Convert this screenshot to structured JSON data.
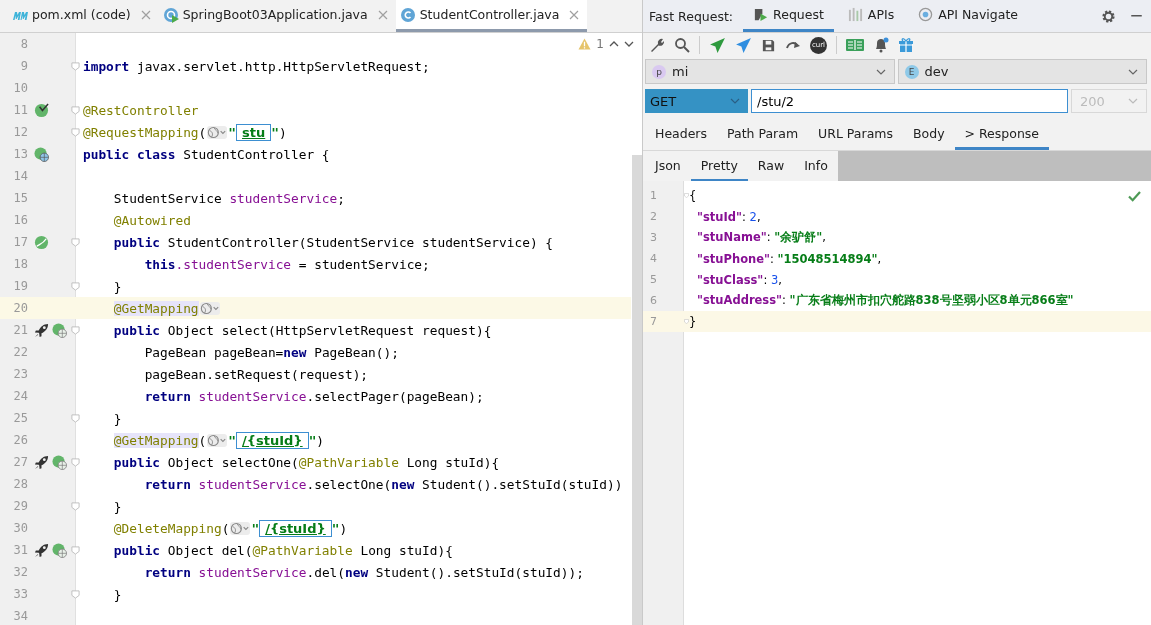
{
  "editor_tabs": [
    {
      "label": "pom.xml (code)",
      "selected": false
    },
    {
      "label": "SpringBoot03Application.java",
      "selected": false
    },
    {
      "label": "StudentController.java",
      "selected": true
    }
  ],
  "inspections": {
    "warnings": "1"
  },
  "code_lines": [
    {
      "number": "8",
      "fold": false,
      "current": false
    },
    {
      "number": "9",
      "fold": true,
      "current": false,
      "tokens": [
        {
          "kind": "kw",
          "text": "import"
        },
        {
          "kind": "plain",
          "text": " javax.servlet.http.HttpServletRequest;"
        }
      ]
    },
    {
      "number": "10",
      "fold": false,
      "current": false
    },
    {
      "number": "11",
      "markers": [
        {
          "kind": "bean-check"
        }
      ],
      "fold": true,
      "current": false,
      "tokens": [
        {
          "kind": "ann",
          "text": "@RestController"
        }
      ]
    },
    {
      "number": "12",
      "fold": true,
      "current": false,
      "tokens": [
        {
          "kind": "ann",
          "text": "@RequestMapping"
        },
        {
          "kind": "plain",
          "text": "("
        },
        {
          "kind": "hint"
        },
        {
          "kind": "str",
          "text": "\""
        },
        {
          "kind": "url",
          "text": "stu"
        },
        {
          "kind": "str",
          "text": "\""
        },
        {
          "kind": "plain",
          "text": ")"
        }
      ]
    },
    {
      "number": "13",
      "markers": [
        {
          "kind": "bean-web"
        }
      ],
      "fold": false,
      "current": false,
      "tokens": [
        {
          "kind": "kw",
          "text": "public class"
        },
        {
          "kind": "plain",
          "text": " StudentController {"
        }
      ]
    },
    {
      "number": "14",
      "fold": false,
      "current": false
    },
    {
      "number": "15",
      "fold": false,
      "current": false,
      "tokens": [
        {
          "kind": "plain",
          "text": "    StudentService "
        },
        {
          "kind": "field",
          "text": "studentService"
        },
        {
          "kind": "plain",
          "text": ";"
        }
      ]
    },
    {
      "number": "16",
      "fold": false,
      "current": false,
      "tokens": [
        {
          "kind": "ann",
          "text": "    @Autowired"
        }
      ]
    },
    {
      "number": "17",
      "markers": [
        {
          "kind": "bean"
        }
      ],
      "fold": true,
      "current": false,
      "tokens": [
        {
          "kind": "kw",
          "text": "    public"
        },
        {
          "kind": "plain",
          "text": " StudentController(StudentService studentService) {"
        }
      ]
    },
    {
      "number": "18",
      "fold": false,
      "current": false,
      "tokens": [
        {
          "kind": "kw",
          "text": "        this"
        },
        {
          "kind": "field",
          "text": ".studentService"
        },
        {
          "kind": "plain",
          "text": " = studentService;"
        }
      ]
    },
    {
      "number": "19",
      "fold": true,
      "current": false,
      "tokens": [
        {
          "kind": "plain",
          "text": "    }"
        }
      ]
    },
    {
      "number": "20",
      "fold": false,
      "current": true,
      "tokens": [
        {
          "kind": "annhl",
          "text": "    @GetMapping"
        },
        {
          "kind": "hint"
        }
      ]
    },
    {
      "number": "21",
      "markers": [
        {
          "kind": "rocket"
        },
        {
          "kind": "web"
        }
      ],
      "fold": true,
      "current": false,
      "tokens": [
        {
          "kind": "kw",
          "text": "    public"
        },
        {
          "kind": "plain",
          "text": " Object select(HttpServletRequest request){"
        }
      ]
    },
    {
      "number": "22",
      "fold": false,
      "current": false,
      "tokens": [
        {
          "kind": "plain",
          "text": "        PageBean pageBean="
        },
        {
          "kind": "kw",
          "text": "new"
        },
        {
          "kind": "plain",
          "text": " PageBean();"
        }
      ]
    },
    {
      "number": "23",
      "fold": false,
      "current": false,
      "tokens": [
        {
          "kind": "plain",
          "text": "        pageBean.setRequest(request);"
        }
      ]
    },
    {
      "number": "24",
      "fold": false,
      "current": false,
      "tokens": [
        {
          "kind": "kw",
          "text": "        return"
        },
        {
          "kind": "field",
          "text": " studentService"
        },
        {
          "kind": "plain",
          "text": ".selectPager(pageBean);"
        }
      ]
    },
    {
      "number": "25",
      "fold": true,
      "current": false,
      "tokens": [
        {
          "kind": "plain",
          "text": "    }"
        }
      ]
    },
    {
      "number": "26",
      "fold": false,
      "current": false,
      "tokens": [
        {
          "kind": "annhl",
          "text": "    @GetMapping"
        },
        {
          "kind": "plain",
          "text": "("
        },
        {
          "kind": "hint"
        },
        {
          "kind": "str",
          "text": "\""
        },
        {
          "kind": "url",
          "text": "/{stuId}"
        },
        {
          "kind": "str",
          "text": "\""
        },
        {
          "kind": "plain",
          "text": ")"
        }
      ]
    },
    {
      "number": "27",
      "markers": [
        {
          "kind": "rocket"
        },
        {
          "kind": "web"
        }
      ],
      "fold": true,
      "current": false,
      "tokens": [
        {
          "kind": "kw",
          "text": "    public"
        },
        {
          "kind": "plain",
          "text": " Object selectOne("
        },
        {
          "kind": "ann",
          "text": "@PathVariable"
        },
        {
          "kind": "plain",
          "text": " Long stuId){"
        }
      ]
    },
    {
      "number": "28",
      "fold": false,
      "current": false,
      "tokens": [
        {
          "kind": "kw",
          "text": "        return"
        },
        {
          "kind": "field",
          "text": " studentService"
        },
        {
          "kind": "plain",
          "text": ".selectOne("
        },
        {
          "kind": "kw",
          "text": "new"
        },
        {
          "kind": "plain",
          "text": " Student().setStuId(stuId))"
        }
      ]
    },
    {
      "number": "29",
      "fold": true,
      "current": false,
      "tokens": [
        {
          "kind": "plain",
          "text": "    }"
        }
      ]
    },
    {
      "number": "30",
      "fold": false,
      "current": false,
      "tokens": [
        {
          "kind": "ann",
          "text": "    @DeleteMapping"
        },
        {
          "kind": "plain",
          "text": "("
        },
        {
          "kind": "hint"
        },
        {
          "kind": "str",
          "text": "\""
        },
        {
          "kind": "url",
          "text": "/{stuId}"
        },
        {
          "kind": "str",
          "text": "\""
        },
        {
          "kind": "plain",
          "text": ")"
        }
      ]
    },
    {
      "number": "31",
      "markers": [
        {
          "kind": "rocket"
        },
        {
          "kind": "web"
        }
      ],
      "fold": true,
      "current": false,
      "tokens": [
        {
          "kind": "kw",
          "text": "    public"
        },
        {
          "kind": "plain",
          "text": " Object del("
        },
        {
          "kind": "ann",
          "text": "@PathVariable"
        },
        {
          "kind": "plain",
          "text": " Long stuId){"
        }
      ]
    },
    {
      "number": "32",
      "fold": false,
      "current": false,
      "tokens": [
        {
          "kind": "kw",
          "text": "        return"
        },
        {
          "kind": "field",
          "text": " studentService"
        },
        {
          "kind": "plain",
          "text": ".del("
        },
        {
          "kind": "kw",
          "text": "new"
        },
        {
          "kind": "plain",
          "text": " Student().setStuId(stuId));"
        }
      ]
    },
    {
      "number": "33",
      "fold": true,
      "current": false,
      "tokens": [
        {
          "kind": "plain",
          "text": "    }"
        }
      ]
    },
    {
      "number": "34",
      "fold": false,
      "current": false
    }
  ],
  "fast_request": {
    "title": "Fast Request:",
    "tabs": [
      {
        "label": "Request",
        "selected": true
      },
      {
        "label": "APIs",
        "selected": false
      },
      {
        "label": "API Navigate",
        "selected": false
      }
    ],
    "curl_label": "curl",
    "project": {
      "badge": "p",
      "value": "mi"
    },
    "environment": {
      "badge": "E",
      "value": "dev"
    },
    "method": "GET",
    "url": "/stu/2",
    "status": "200",
    "request_tabs": [
      {
        "label": "Headers",
        "selected": false
      },
      {
        "label": "Path Param",
        "selected": false
      },
      {
        "label": "URL Params",
        "selected": false
      },
      {
        "label": "Body",
        "selected": false
      },
      {
        "label": "> Response",
        "selected": true
      }
    ],
    "response_tabs": [
      {
        "label": "Json",
        "selected": false
      },
      {
        "label": "Pretty",
        "selected": true
      },
      {
        "label": "Raw",
        "selected": false
      },
      {
        "label": "Info",
        "selected": false
      }
    ],
    "valid": true,
    "response_lines": [
      {
        "number": "1",
        "current": false,
        "fold": true,
        "tokens": [
          {
            "kind": "punct",
            "text": "{"
          }
        ]
      },
      {
        "number": "2",
        "current": false,
        "fold": false,
        "tokens": [
          {
            "kind": "key",
            "text": "  \"stuId\""
          },
          {
            "kind": "punct",
            "text": ": "
          },
          {
            "kind": "num",
            "text": "2"
          },
          {
            "kind": "punct",
            "text": ","
          }
        ]
      },
      {
        "number": "3",
        "current": false,
        "fold": false,
        "tokens": [
          {
            "kind": "key",
            "text": "  \"stuName\""
          },
          {
            "kind": "punct",
            "text": ": "
          },
          {
            "kind": "str",
            "text": "\"余驴舒\""
          },
          {
            "kind": "punct",
            "text": ","
          }
        ]
      },
      {
        "number": "4",
        "current": false,
        "fold": false,
        "tokens": [
          {
            "kind": "key",
            "text": "  \"stuPhone\""
          },
          {
            "kind": "punct",
            "text": ": "
          },
          {
            "kind": "str",
            "text": "\"15048514894\""
          },
          {
            "kind": "punct",
            "text": ","
          }
        ]
      },
      {
        "number": "5",
        "current": false,
        "fold": false,
        "tokens": [
          {
            "kind": "key",
            "text": "  \"stuClass\""
          },
          {
            "kind": "punct",
            "text": ": "
          },
          {
            "kind": "num",
            "text": "3"
          },
          {
            "kind": "punct",
            "text": ","
          }
        ]
      },
      {
        "number": "6",
        "current": false,
        "fold": false,
        "tokens": [
          {
            "kind": "key",
            "text": "  \"stuAddress\""
          },
          {
            "kind": "punct",
            "text": ": "
          },
          {
            "kind": "str",
            "text": "\"广东省梅州市扣穴舵路838号坚弱小区8单元866室\""
          }
        ]
      },
      {
        "number": "7",
        "current": true,
        "fold": true,
        "tokens": [
          {
            "kind": "punct",
            "text": "}"
          }
        ]
      }
    ]
  }
}
